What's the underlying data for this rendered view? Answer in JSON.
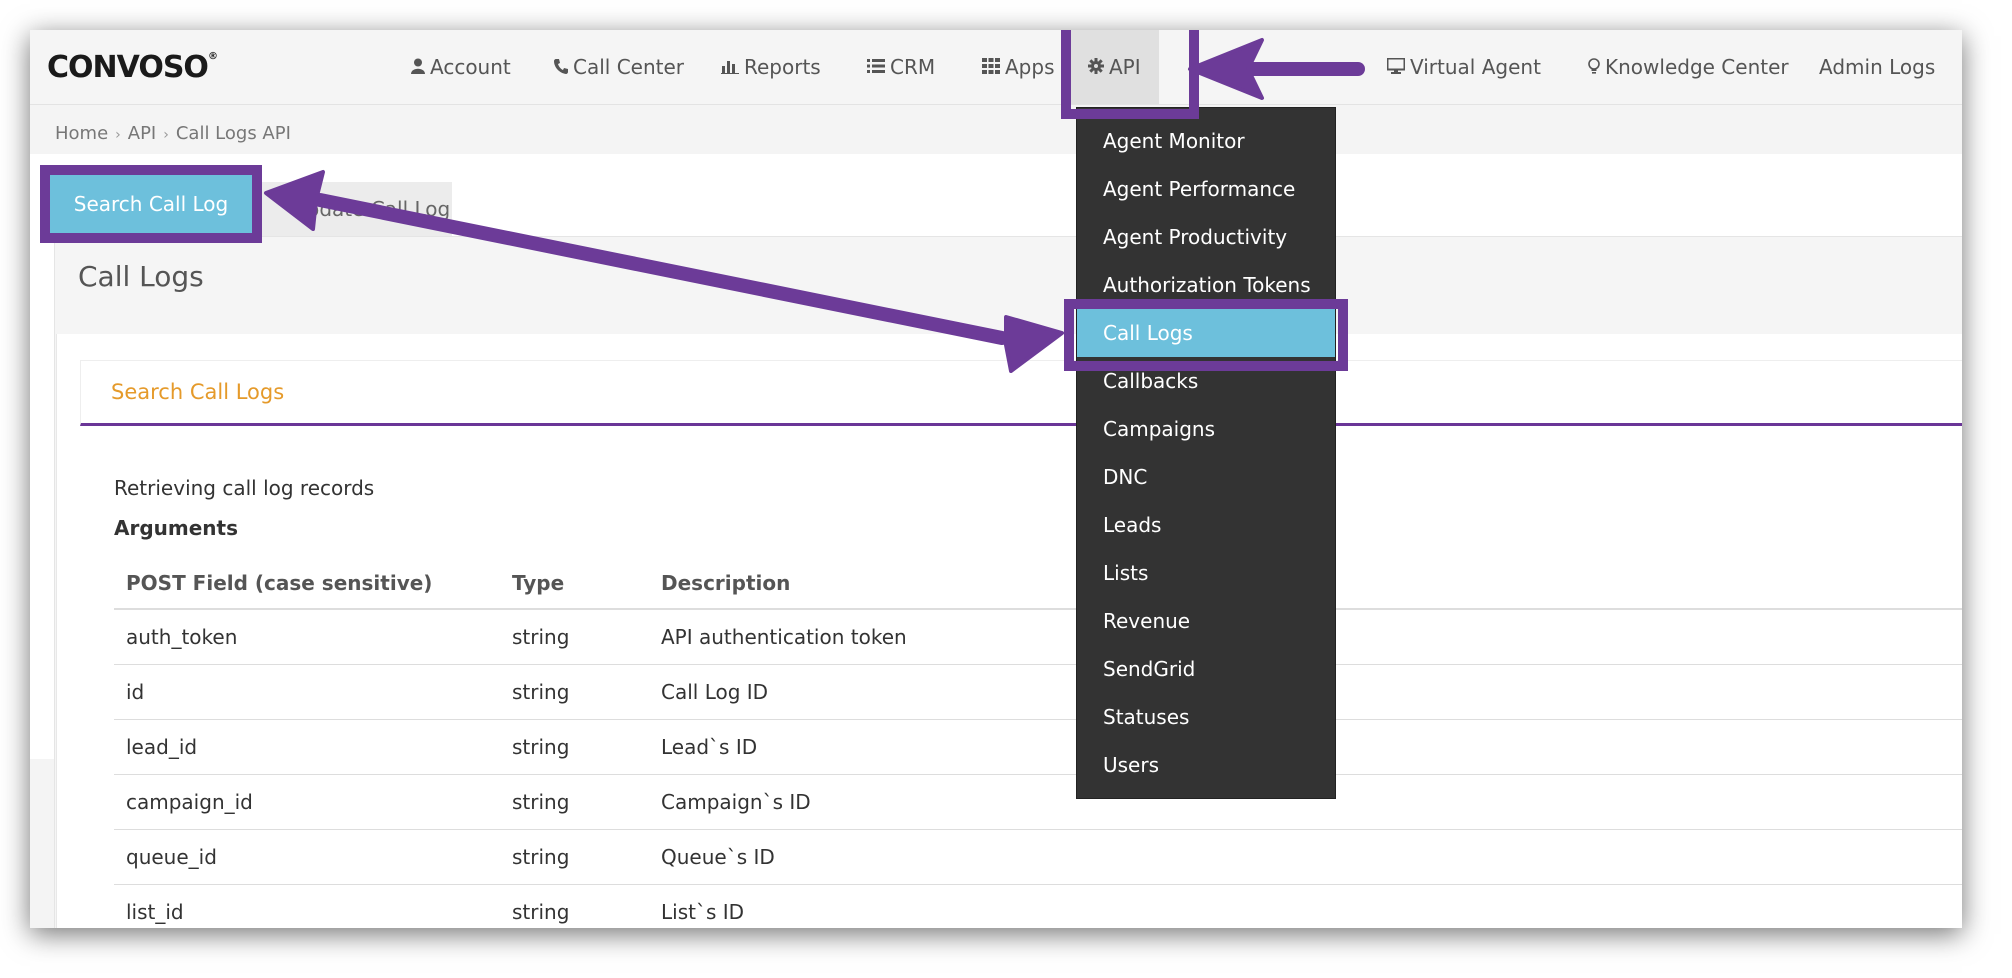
{
  "logo": {
    "text": "CONVOSO",
    "tm": "®"
  },
  "nav": {
    "items": [
      {
        "icon": "user-icon",
        "label": "Account"
      },
      {
        "icon": "phone-icon",
        "label": "Call Center"
      },
      {
        "icon": "bar-chart-icon",
        "label": "Reports"
      },
      {
        "icon": "list-icon",
        "label": "CRM"
      },
      {
        "icon": "grid-icon",
        "label": "Apps"
      },
      {
        "icon": "gear-icon",
        "label": "API"
      },
      {
        "icon": "desktop-icon",
        "label": "Virtual Agent"
      },
      {
        "icon": "lightbulb-icon",
        "label": "Knowledge Center"
      },
      {
        "icon": "",
        "label": "Admin Logs"
      }
    ],
    "active": "API"
  },
  "breadcrumb": [
    "Home",
    "API",
    "Call Logs API"
  ],
  "tabs": {
    "search": "Search Call Log",
    "update": "Update Call Log"
  },
  "page_title": "Call Logs",
  "section_title": "Search Call Logs",
  "description": "Retrieving call log records",
  "arguments_label": "Arguments",
  "table": {
    "headers": [
      "POST Field (case sensitive)",
      "Type",
      "Description"
    ],
    "rows": [
      [
        "auth_token",
        "string",
        "API authentication token"
      ],
      [
        "id",
        "string",
        "Call Log ID"
      ],
      [
        "lead_id",
        "string",
        "Lead`s ID"
      ],
      [
        "campaign_id",
        "string",
        "Campaign`s ID"
      ],
      [
        "queue_id",
        "string",
        "Queue`s ID"
      ],
      [
        "list_id",
        "string",
        "List`s ID"
      ]
    ]
  },
  "dropdown": {
    "items": [
      "Agent Monitor",
      "Agent Performance",
      "Agent Productivity",
      "Authorization Tokens",
      "Call Logs",
      "Callbacks",
      "Campaigns",
      "DNC",
      "Leads",
      "Lists",
      "Revenue",
      "SendGrid",
      "Statuses",
      "Users"
    ],
    "selected": "Call Logs"
  },
  "colors": {
    "annotation": "#6c3b98",
    "selected": "#6dc0dc",
    "section_title": "#e59a2a"
  }
}
